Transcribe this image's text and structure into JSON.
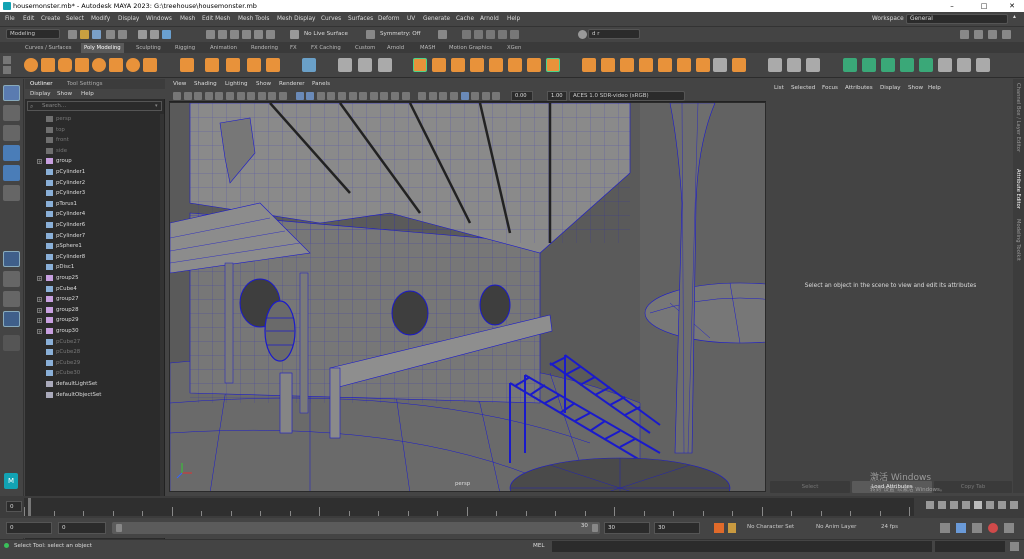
{
  "window": {
    "title": "housemonster.mb* - Autodesk MAYA 2023: G:\\treehouse\\housemonster.mb",
    "controls": [
      "–",
      "□",
      "✕"
    ]
  },
  "menubar": {
    "items": [
      "File",
      "Edit",
      "Create",
      "Select",
      "Modify",
      "Display",
      "Windows",
      "Mesh",
      "Edit Mesh",
      "Mesh Tools",
      "Mesh Display",
      "Curves",
      "Surfaces",
      "Deform",
      "UV",
      "Generate",
      "Cache",
      "Arnold",
      "Help"
    ],
    "workspace_label": "Workspace :",
    "workspace_value": "General"
  },
  "statusline": {
    "mode": "Modeling",
    "live_surface": "No Live Surface",
    "symmetry": "Symmetry: Off",
    "user": "d r"
  },
  "shelf_tabs": [
    "Curves / Surfaces",
    "Poly Modeling",
    "Sculpting",
    "Rigging",
    "Animation",
    "Rendering",
    "FX",
    "FX Caching",
    "Custom",
    "Arnold",
    "MASH",
    "Motion Graphics",
    "XGen"
  ],
  "shelf_active": "Poly Modeling",
  "outliner": {
    "tabs": [
      "Outliner",
      "Tool Settings"
    ],
    "menu": [
      "Display",
      "Show",
      "Help"
    ],
    "search_placeholder": "Search...",
    "items": [
      {
        "label": "persp",
        "type": "camera",
        "dim": true,
        "expand": false
      },
      {
        "label": "top",
        "type": "camera",
        "dim": true,
        "expand": false
      },
      {
        "label": "front",
        "type": "camera",
        "dim": true,
        "expand": false
      },
      {
        "label": "side",
        "type": "camera",
        "dim": true,
        "expand": false
      },
      {
        "label": "group",
        "type": "group",
        "dim": false,
        "expand": true
      },
      {
        "label": "pCylinder1",
        "type": "mesh",
        "dim": false,
        "expand": false
      },
      {
        "label": "pCylinder2",
        "type": "mesh",
        "dim": false,
        "expand": false
      },
      {
        "label": "pCylinder3",
        "type": "mesh",
        "dim": false,
        "expand": false
      },
      {
        "label": "pTorus1",
        "type": "mesh",
        "dim": false,
        "expand": false
      },
      {
        "label": "pCylinder4",
        "type": "mesh",
        "dim": false,
        "expand": false
      },
      {
        "label": "pCylinder6",
        "type": "mesh",
        "dim": false,
        "expand": false
      },
      {
        "label": "pCylinder7",
        "type": "mesh",
        "dim": false,
        "expand": false
      },
      {
        "label": "pSphere1",
        "type": "mesh",
        "dim": false,
        "expand": false
      },
      {
        "label": "pCylinder8",
        "type": "mesh",
        "dim": false,
        "expand": false
      },
      {
        "label": "pDisc1",
        "type": "mesh",
        "dim": false,
        "expand": false
      },
      {
        "label": "group25",
        "type": "group",
        "dim": false,
        "expand": true
      },
      {
        "label": "pCube4",
        "type": "mesh",
        "dim": false,
        "expand": false
      },
      {
        "label": "group27",
        "type": "group",
        "dim": false,
        "expand": true
      },
      {
        "label": "group28",
        "type": "group",
        "dim": false,
        "expand": true
      },
      {
        "label": "group29",
        "type": "group",
        "dim": false,
        "expand": true
      },
      {
        "label": "group30",
        "type": "group",
        "dim": false,
        "expand": true
      },
      {
        "label": "pCube27",
        "type": "mesh",
        "dim": true,
        "expand": false
      },
      {
        "label": "pCube28",
        "type": "mesh",
        "dim": true,
        "expand": false
      },
      {
        "label": "pCube29",
        "type": "mesh",
        "dim": true,
        "expand": false
      },
      {
        "label": "pCube30",
        "type": "mesh",
        "dim": true,
        "expand": false
      },
      {
        "label": "defaultLightSet",
        "type": "set",
        "dim": false,
        "expand": false
      },
      {
        "label": "defaultObjectSet",
        "type": "set",
        "dim": false,
        "expand": false
      }
    ]
  },
  "viewport": {
    "menu": [
      "View",
      "Shading",
      "Lighting",
      "Show",
      "Renderer",
      "Panels"
    ],
    "exposure": "0.00",
    "gamma": "1.00",
    "colorspace": "ACES 1.0 SDR-video (sRGB)",
    "camera_label": "persp",
    "accent": "#1a1acc"
  },
  "attribute_editor": {
    "menu": [
      "List",
      "Selected",
      "Focus",
      "Attributes",
      "Display",
      "Show",
      "Help"
    ],
    "message": "Select an object in the scene to view and edit its attributes",
    "buttons": [
      "Select",
      "Load Attributes",
      "Copy Tab"
    ]
  },
  "side_tabs": [
    "Channel Box / Layer Editor",
    "Attribute Editor",
    "Modeling Toolkit"
  ],
  "timeline": {
    "current_frame": "0",
    "start": "0",
    "range_start": "0",
    "range_end_handle": "30",
    "range_end": "30",
    "end": "30",
    "character_set": "No Character Set",
    "anim_layer": "No Anim Layer",
    "fps": "24 fps"
  },
  "watermark": {
    "line1": "激活 Windows",
    "line2": "转到\"设置\"以激活 Windows。"
  },
  "cmdline": {
    "help": "Select Tool: select an object",
    "lang": "MEL"
  }
}
